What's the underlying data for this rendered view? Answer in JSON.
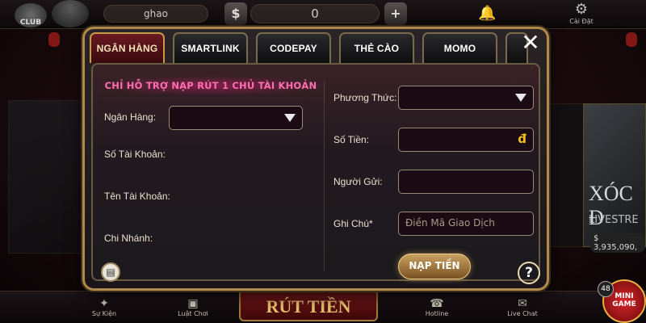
{
  "background": {
    "logo_text": "CLUB",
    "username": "ghao",
    "balance": "0",
    "coin_minus": "$",
    "coin_plus": "+",
    "settings_label": "Cài Đặt",
    "right_card_title": "XÓC Đ",
    "right_card_sub": "LIVESTRE",
    "right_card_amount": "$ 3,935,090,",
    "withdraw_banner": "RÚT TIỀN",
    "nav": [
      {
        "label": "Sự Kiện",
        "icon": "gift-icon"
      },
      {
        "label": "Luật Chơi",
        "icon": "book-icon"
      },
      {
        "label": "Hotline",
        "icon": "phone-icon"
      },
      {
        "label": "Live Chat",
        "icon": "chat-icon"
      }
    ],
    "minigame_label": "MINI GAME",
    "minigame_badge": "48"
  },
  "modal": {
    "tabs": [
      {
        "label": "NGÂN HÀNG",
        "active": true
      },
      {
        "label": "SMARTLINK",
        "active": false
      },
      {
        "label": "CODEPAY",
        "active": false
      },
      {
        "label": "THẺ CÀO",
        "active": false
      },
      {
        "label": "MOMO",
        "active": false
      }
    ],
    "close_symbol": "✕",
    "notice": "CHỈ HỖ TRỢ NẠP RÚT 1 CHỦ TÀI KHOẢN",
    "left": {
      "bank_label": "Ngân Hàng:",
      "account_number_label": "Số Tài Khoản:",
      "account_name_label": "Tên Tài Khoản:",
      "branch_label": "Chi Nhánh:"
    },
    "right": {
      "method_label": "Phương Thức:",
      "amount_label": "Số Tiền:",
      "amount_currency": "đ",
      "sender_label": "Người Gửi:",
      "note_label": "Ghi Chú*",
      "note_placeholder": "Điền Mã Giao Dịch"
    },
    "submit_label": "NẠP TIỀN",
    "help_symbol": "?"
  },
  "colors": {
    "accent_gold": "#b08a4a",
    "active_tab": "#6a1a20",
    "notice_text": "#ff6fb0",
    "currency": "#f0c020"
  }
}
